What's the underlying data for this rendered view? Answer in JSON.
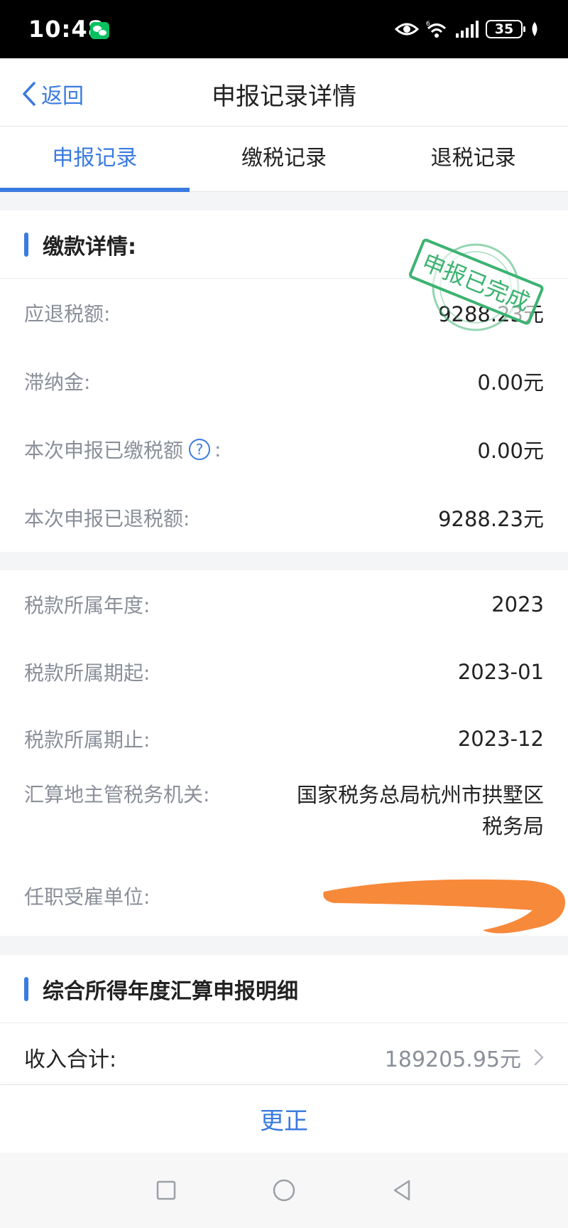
{
  "status_bar": {
    "time": "10:48",
    "battery": "35",
    "network": "6"
  },
  "nav": {
    "back_label": "返回",
    "title": "申报记录详情"
  },
  "tabs": [
    {
      "label": "申报记录",
      "active": true
    },
    {
      "label": "缴税记录",
      "active": false
    },
    {
      "label": "退税记录",
      "active": false
    }
  ],
  "payment_section": {
    "title": "缴款详情:",
    "stamp_text": "申报已完成",
    "rows": [
      {
        "label": "应退税额:",
        "value": "9288.23元"
      },
      {
        "label": "滞纳金:",
        "value": "0.00元"
      },
      {
        "label": "本次申报已缴税额",
        "suffix": ":",
        "value": "0.00元"
      },
      {
        "label": "本次申报已退税额:",
        "value": "9288.23元"
      }
    ]
  },
  "period_section": {
    "rows": [
      {
        "label": "税款所属年度:",
        "value": "2023"
      },
      {
        "label": "税款所属期起:",
        "value": "2023-01"
      },
      {
        "label": "税款所属期止:",
        "value": "2023-12"
      },
      {
        "label": "汇算地主管税务机关:",
        "value_line1": "国家税务总局杭州市拱墅区",
        "value_line2": "税务局"
      },
      {
        "label": "任职受雇单位:",
        "value": ""
      }
    ]
  },
  "annual_section": {
    "title": "综合所得年度汇算申报明细",
    "income_label": "收入合计:",
    "income_value": "189205.95元"
  },
  "bottom": {
    "correct_label": "更正"
  },
  "colors": {
    "accent": "#3a7be0",
    "stamp": "#3cb371",
    "redaction": "#f7893b"
  }
}
